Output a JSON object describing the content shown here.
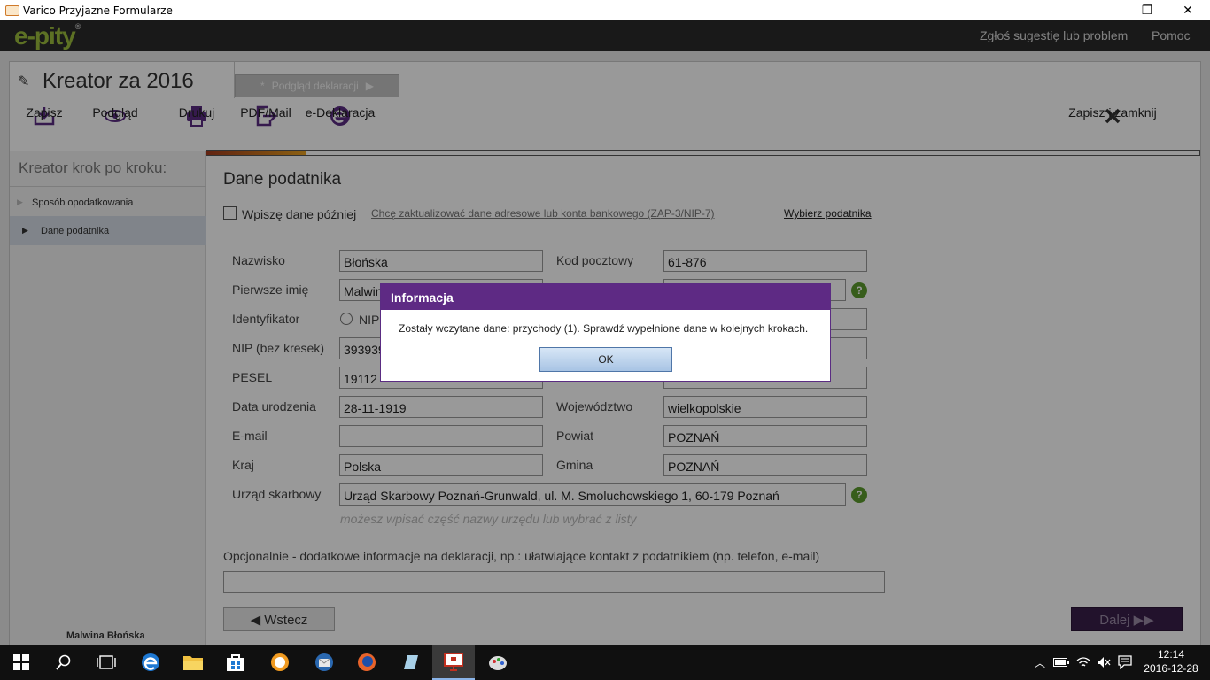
{
  "window": {
    "title": "Varico Przyjazne Formularze",
    "minimize": "—",
    "maximize": "❐",
    "close": "✕"
  },
  "header": {
    "logo": "e-pity",
    "logo_mark": "®",
    "report_link": "Zgłoś sugestię lub problem",
    "help_link": "Pomoc"
  },
  "wizard": {
    "title": "Kreator za 2016",
    "preview_tab": "Podgląd deklaracji"
  },
  "toolbar": {
    "save": "Zapisz",
    "preview": "Podgląd",
    "print": "Drukuj",
    "pdf": "PDF/Mail",
    "edecl": "e-Deklaracja",
    "save_close": "Zapisz i zamknij"
  },
  "progress": {
    "fraction": 0.1
  },
  "sidebar": {
    "heading": "Kreator krok po kroku:",
    "items": [
      {
        "label": "Sposób opodatkowania"
      },
      {
        "label": "Dane podatnika"
      }
    ],
    "user": "Malwina Błońska"
  },
  "form": {
    "section_title": "Dane podatnika",
    "later_label": "Wpiszę dane później",
    "update_link": "Chcę zaktualizować dane adresowe lub konta bankowego (ZAP-3/NIP-7)",
    "choose_link": "Wybierz podatnika",
    "nazwisko_label": "Nazwisko",
    "nazwisko": "Błońska",
    "imie_label": "Pierwsze imię",
    "imie": "Malwin",
    "id_label": "Identyfikator",
    "id_option": "NIP",
    "nip_label": "NIP (bez kresek)",
    "nip": "393939",
    "pesel_label": "PESEL",
    "pesel": "19112",
    "dob_label": "Data urodzenia",
    "dob": "28-11-1919",
    "email_label": "E-mail",
    "email": "",
    "kraj_label": "Kraj",
    "kraj": "Polska",
    "us_label": "Urząd skarbowy",
    "us": "Urząd Skarbowy Poznań-Grunwald, ul. M. Smoluchowskiego 1, 60-179 Poznań",
    "us_hint": "możesz wpisać część nazwy urzędu lub wybrać z listy",
    "kod_label": "Kod pocztowy",
    "kod": "61-876",
    "woj_label": "Województwo",
    "woj": "wielkopolskie",
    "powiat_label": "Powiat",
    "powiat": "POZNAŃ",
    "gmina_label": "Gmina",
    "gmina": "POZNAŃ",
    "opt_label": "Opcjonalnie - dodatkowe informacje na deklaracji, np.: ułatwiające kontakt z podatnikiem (np. telefon, e-mail)",
    "opt_value": "",
    "help_glyph": "?"
  },
  "nav": {
    "back": "◀ Wstecz",
    "next": "Dalej ▶▶"
  },
  "dialog": {
    "title": "Informacja",
    "message": "Zostały wczytane dane:  przychody (1). Sprawdź wypełnione dane w kolejnych krokach.",
    "ok": "OK"
  },
  "taskbar": {
    "time": "12:14",
    "date": "2016-12-28"
  }
}
